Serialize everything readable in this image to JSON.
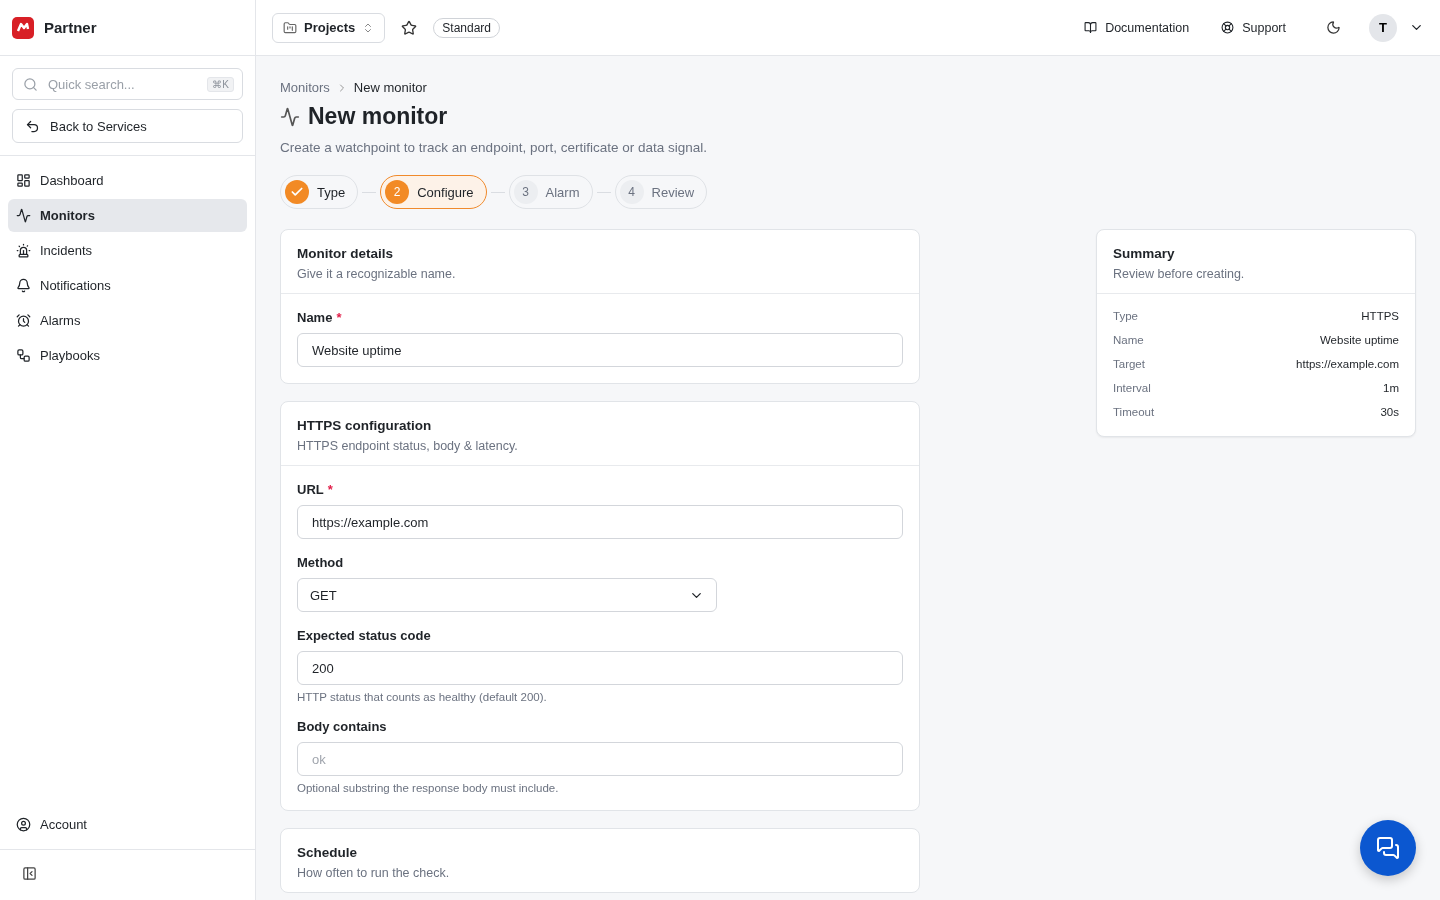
{
  "brand": {
    "name": "Partner"
  },
  "sidebar": {
    "search": {
      "placeholder": "Quick search...",
      "shortcut": "⌘K"
    },
    "back_button": "Back to Services",
    "items": [
      {
        "label": "Dashboard",
        "selected": false
      },
      {
        "label": "Monitors",
        "selected": true
      },
      {
        "label": "Incidents",
        "selected": false
      },
      {
        "label": "Notifications",
        "selected": false
      },
      {
        "label": "Alarms",
        "selected": false
      },
      {
        "label": "Playbooks",
        "selected": false
      }
    ],
    "footer_item": "Account"
  },
  "topbar": {
    "project_switcher": "Projects",
    "plan_badge": "Standard",
    "links": [
      "Documentation",
      "Support"
    ],
    "avatar": "T"
  },
  "breadcrumb": [
    "Monitors",
    "New monitor"
  ],
  "page": {
    "title": "New monitor",
    "subtitle": "Create a watchpoint to track an endpoint, port, certificate or data signal."
  },
  "steps": [
    {
      "label": "Type",
      "kind": "done"
    },
    {
      "marker": "2",
      "label": "Configure",
      "kind": "current"
    },
    {
      "marker": "3",
      "label": "Alarm",
      "kind": "pending"
    },
    {
      "marker": "4",
      "label": "Review",
      "kind": "pending"
    }
  ],
  "cards": [
    {
      "title": "Monitor details",
      "description": "Give it a recognizable name.",
      "fields": [
        {
          "kind": "input",
          "label": "Name",
          "required_mark": "*",
          "value": "Website uptime"
        }
      ]
    },
    {
      "title": "HTTPS configuration",
      "description": "HTTPS endpoint status, body & latency.",
      "fields": [
        {
          "kind": "input",
          "label": "URL",
          "required_mark": "*",
          "value": "https://example.com"
        },
        {
          "kind": "select",
          "label": "Method",
          "value": "GET"
        },
        {
          "kind": "input",
          "label": "Expected status code",
          "value": "200",
          "hint": "HTTP status that counts as healthy (default 200)."
        },
        {
          "kind": "input",
          "label": "Body contains",
          "placeholder": "ok",
          "hint": "Optional substring the response body must include."
        }
      ]
    },
    {
      "title": "Schedule",
      "description": "How often to run the check."
    }
  ],
  "summary": {
    "title": "Summary",
    "description": "Review before creating.",
    "rows": [
      {
        "label": "Type",
        "value": "HTTPS"
      },
      {
        "label": "Name",
        "value": "Website uptime"
      },
      {
        "label": "Target",
        "value": "https://example.com"
      },
      {
        "label": "Interval",
        "value": "1m"
      },
      {
        "label": "Timeout",
        "value": "30s"
      }
    ]
  }
}
